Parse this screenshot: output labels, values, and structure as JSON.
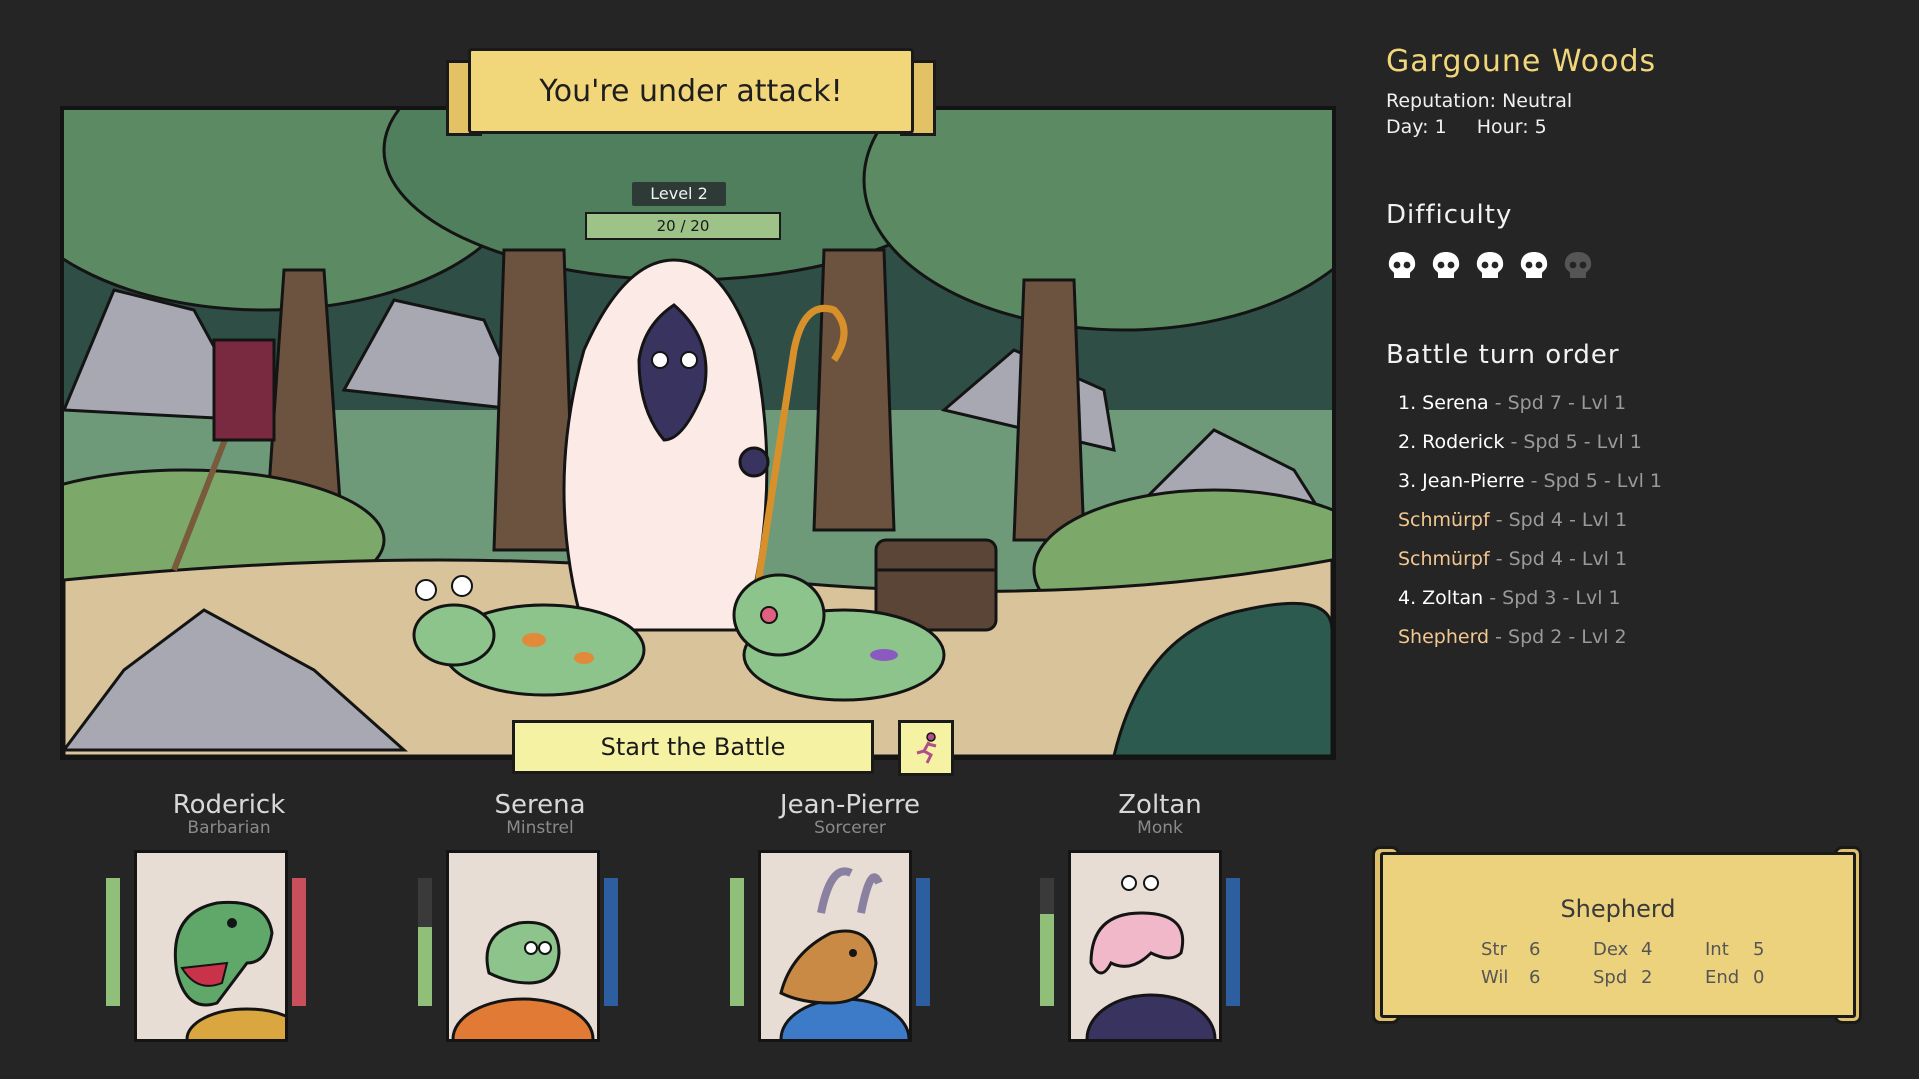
{
  "banner": {
    "title": "You're under attack!"
  },
  "enemy": {
    "level": "Level 2",
    "hp": "20 / 20"
  },
  "start_button": {
    "label": "Start the Battle"
  },
  "location": {
    "name": "Gargoune Woods",
    "reputation": "Reputation: Neutral",
    "day": "Day: 1",
    "hour": "Hour: 5"
  },
  "difficulty": {
    "title": "Difficulty",
    "level": 4,
    "max": 5
  },
  "turn_order": {
    "title": "Battle turn order",
    "items": [
      {
        "name": "1. Serena",
        "rest": " - Spd 7 - Lvl 1",
        "kind": "hero"
      },
      {
        "name": "2. Roderick",
        "rest": " - Spd 5 - Lvl 1",
        "kind": "hero"
      },
      {
        "name": "3. Jean-Pierre",
        "rest": " - Spd 5 - Lvl 1",
        "kind": "hero"
      },
      {
        "name": "Schmürpf",
        "rest": " - Spd 4 - Lvl 1",
        "kind": "enemy"
      },
      {
        "name": "Schmürpf",
        "rest": " - Spd 4 - Lvl 1",
        "kind": "enemy"
      },
      {
        "name": "4. Zoltan",
        "rest": " - Spd 3 - Lvl 1",
        "kind": "hero"
      },
      {
        "name": "Shepherd",
        "rest": " - Spd 2 - Lvl 2",
        "kind": "enemy"
      }
    ]
  },
  "heroes": [
    {
      "name": "Roderick",
      "class": "Barbarian",
      "health": 1.0,
      "secondary": 1.0,
      "secondary_color": "#c94f5d"
    },
    {
      "name": "Serena",
      "class": "Minstrel",
      "health": 0.62,
      "secondary": 1.0,
      "secondary_color": "#2d5fa0"
    },
    {
      "name": "Jean-Pierre",
      "class": "Sorcerer",
      "health": 1.0,
      "secondary": 1.0,
      "secondary_color": "#2d5fa0"
    },
    {
      "name": "Zoltan",
      "class": "Monk",
      "health": 0.72,
      "secondary": 1.0,
      "secondary_color": "#2d5fa0"
    }
  ],
  "selected": {
    "name": "Shepherd",
    "stats": [
      [
        {
          "k": "Str",
          "v": "6"
        },
        {
          "k": "Dex",
          "v": "4"
        },
        {
          "k": "Int",
          "v": "5"
        }
      ],
      [
        {
          "k": "Wil",
          "v": "6"
        },
        {
          "k": "Spd",
          "v": "2"
        },
        {
          "k": "End",
          "v": "0"
        }
      ]
    ]
  },
  "colors": {
    "health": "#8fbf79",
    "banner": "#f1d67a",
    "enemy_name": "#f3c790"
  }
}
